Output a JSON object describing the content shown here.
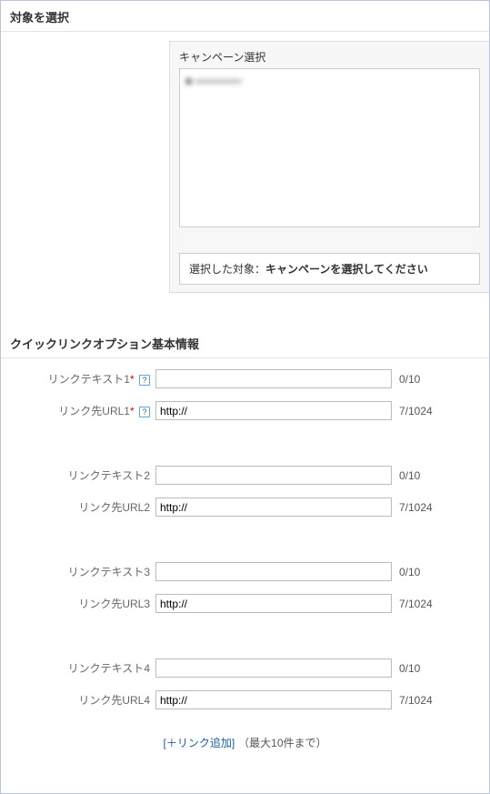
{
  "section1": {
    "title": "対象を選択",
    "campaign_label": "キャンペーン選択",
    "campaign_item": "■ ══════",
    "selected_label": "選択した対象：",
    "selected_value": "キャンペーンを選択してください"
  },
  "section2": {
    "title": "クイックリンクオプション基本情報"
  },
  "rows": [
    {
      "text_label": "リンクテキスト1",
      "url_label": "リンク先URL1",
      "required": true,
      "help": true,
      "text_value": "",
      "text_counter": "0/10",
      "url_value": "http://",
      "url_counter": "7/1024"
    },
    {
      "text_label": "リンクテキスト2",
      "url_label": "リンク先URL2",
      "required": false,
      "help": false,
      "text_value": "",
      "text_counter": "0/10",
      "url_value": "http://",
      "url_counter": "7/1024"
    },
    {
      "text_label": "リンクテキスト3",
      "url_label": "リンク先URL3",
      "required": false,
      "help": false,
      "text_value": "",
      "text_counter": "0/10",
      "url_value": "http://",
      "url_counter": "7/1024"
    },
    {
      "text_label": "リンクテキスト4",
      "url_label": "リンク先URL4",
      "required": false,
      "help": false,
      "text_value": "",
      "text_counter": "0/10",
      "url_value": "http://",
      "url_counter": "7/1024"
    }
  ],
  "add_link": {
    "label": "[＋リンク追加]",
    "note": "（最大10件まで）"
  },
  "required_mark": "*",
  "help_mark": "?"
}
